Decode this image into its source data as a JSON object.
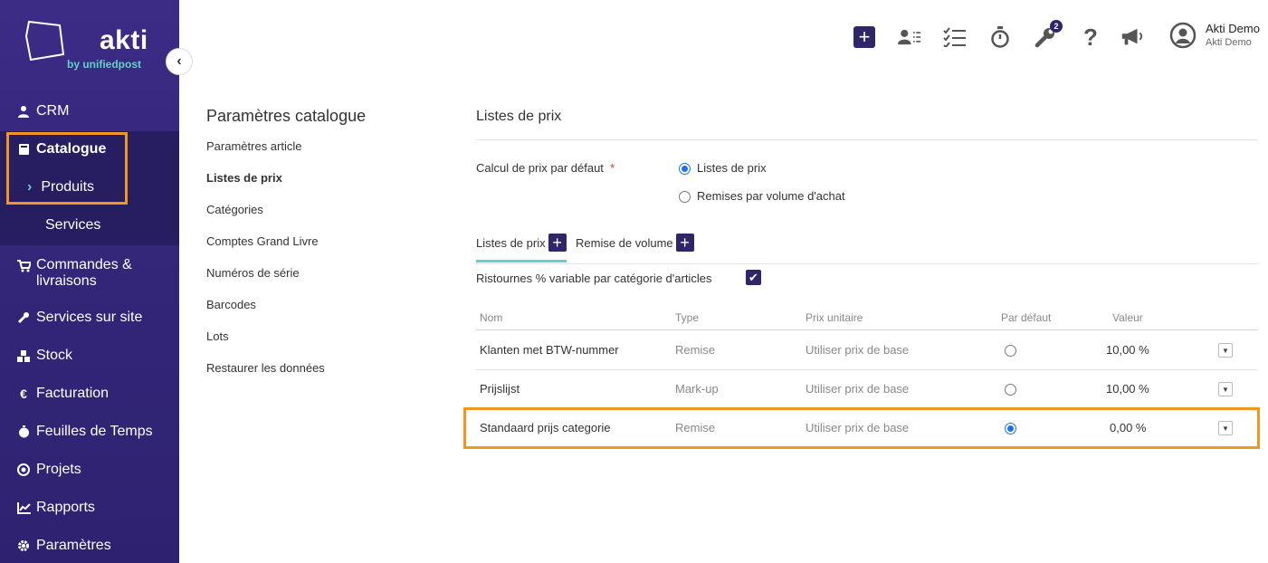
{
  "brand": {
    "name": "akti",
    "tagline": "by unifiedpost",
    "accent": "#5fd3c8",
    "primary": "#2f2668"
  },
  "sidebar": {
    "items": [
      {
        "label": "CRM",
        "icon": "user-icon"
      },
      {
        "label": "Catalogue",
        "icon": "book-icon"
      },
      {
        "label": "Commandes &",
        "label2": "livraisons",
        "icon": "cart-icon"
      },
      {
        "label": "Services sur site",
        "icon": "wrench-icon"
      },
      {
        "label": "Stock",
        "icon": "boxes-icon"
      },
      {
        "label": "Facturation",
        "icon": "euro-icon"
      },
      {
        "label": "Feuilles de Temps",
        "icon": "stopwatch-icon"
      },
      {
        "label": "Projets",
        "icon": "target-icon"
      },
      {
        "label": "Rapports",
        "icon": "chart-icon"
      },
      {
        "label": "Paramètres",
        "icon": "gear-icon"
      }
    ],
    "sub_items": [
      {
        "label": "Produits",
        "icon": "chevron-right-icon"
      },
      {
        "label": "Services"
      }
    ],
    "collapse_icon": "chevron-left-icon"
  },
  "topbar": {
    "icons": [
      "plus-icon",
      "contacts-list-icon",
      "tasks-icon",
      "stopwatch-icon",
      "wrench-icon",
      "help-icon",
      "megaphone-icon",
      "user-circle-icon"
    ],
    "badge": "2",
    "user_name": "Akti Demo",
    "user_company": "Akti Demo"
  },
  "settings_menu": {
    "title": "Paramètres catalogue",
    "links": [
      "Paramètres article",
      "Listes de prix",
      "Catégories",
      "Comptes Grand Livre",
      "Numéros de série",
      "Barcodes",
      "Lots",
      "Restaurer les données"
    ],
    "active": "Listes de prix"
  },
  "main": {
    "title": "Listes de prix",
    "default_calc_label": "Calcul de prix par défaut",
    "required_mark": "*",
    "radio_options": [
      "Listes de prix",
      "Remises par volume d'achat"
    ],
    "tabs": [
      {
        "label": "Listes de prix"
      },
      {
        "label": "Remise de volume"
      }
    ],
    "ristournes_label": "Ristournes % variable par catégorie d'articles",
    "table": {
      "headers": [
        "Nom",
        "Type",
        "Prix unitaire",
        "Par défaut",
        "Valeur"
      ],
      "rows": [
        {
          "name": "Klanten met BTW-nummer",
          "type": "Remise",
          "unit_price": "Utiliser prix de base",
          "default": false,
          "value": "10,00 %"
        },
        {
          "name": "Prijslijst",
          "type": "Mark-up",
          "unit_price": "Utiliser prix de base",
          "default": false,
          "value": "10,00 %"
        },
        {
          "name": "Standaard prijs categorie",
          "type": "Remise",
          "unit_price": "Utiliser prix de base",
          "default": true,
          "value": "0,00 %"
        }
      ]
    }
  }
}
